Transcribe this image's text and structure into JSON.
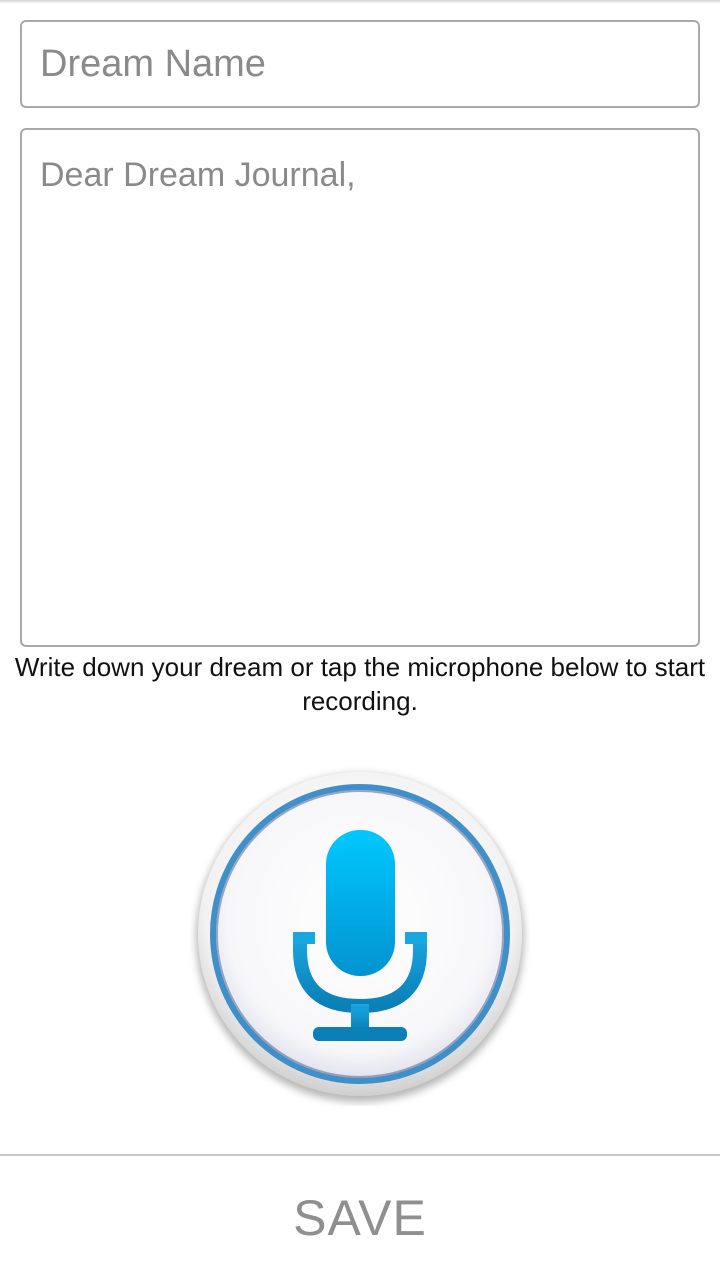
{
  "form": {
    "name_value": "",
    "name_placeholder": "Dream Name",
    "body_value": "",
    "body_placeholder": "Dear Dream Journal,"
  },
  "hint_text": "Write down your dream or tap the microphone below to start recording.",
  "mic": {
    "icon": "microphone-icon",
    "accent": "#00bff2",
    "accent_dark": "#0a7fb8",
    "ring": "#3f8fc9"
  },
  "footer": {
    "save_label": "SAVE"
  }
}
